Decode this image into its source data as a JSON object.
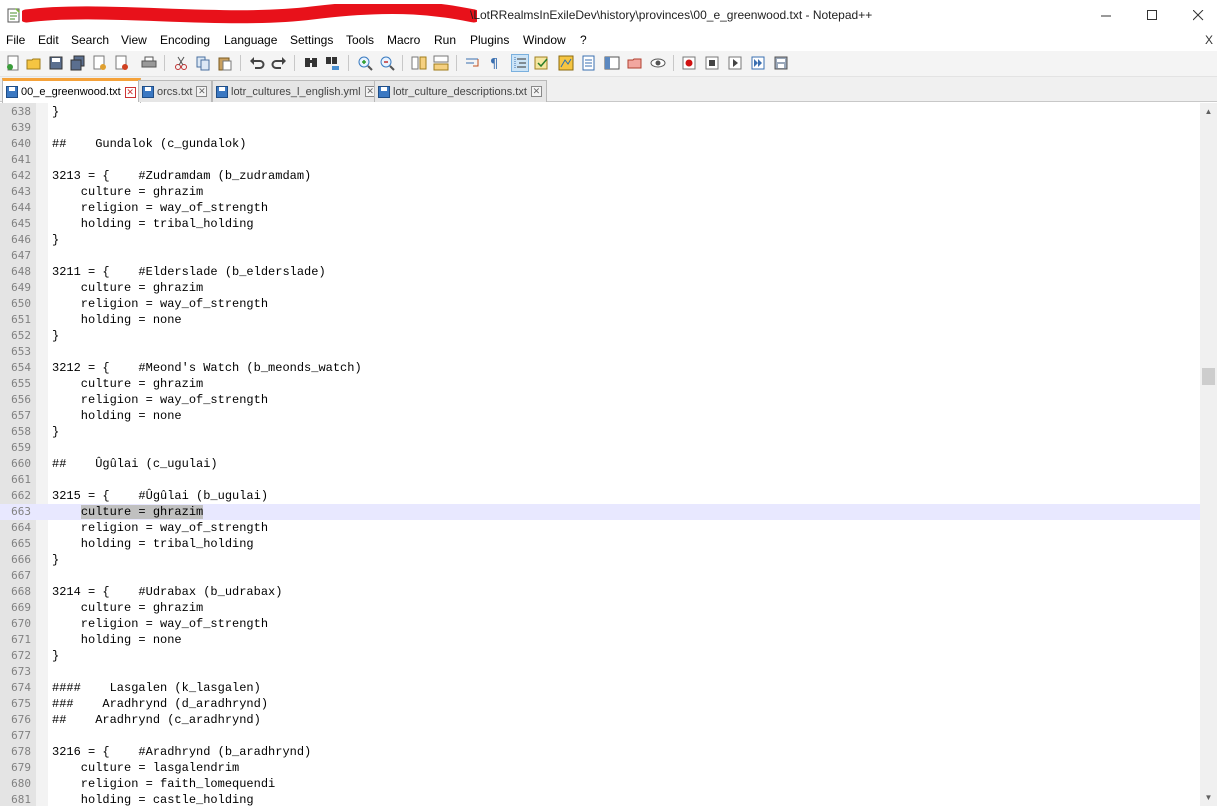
{
  "window": {
    "title": "\\LotRRealmsInExileDev\\history\\provinces\\00_e_greenwood.txt - Notepad++",
    "minimize": "—",
    "maximize": "☐",
    "close": "✕"
  },
  "menu": {
    "items": [
      "File",
      "Edit",
      "Search",
      "View",
      "Encoding",
      "Language",
      "Settings",
      "Tools",
      "Macro",
      "Run",
      "Plugins",
      "Window",
      "?"
    ],
    "close": "X"
  },
  "tabs": [
    {
      "label": "00_e_greenwood.txt",
      "active": true
    },
    {
      "label": "orcs.txt",
      "active": false
    },
    {
      "label": "lotr_cultures_l_english.yml",
      "active": false
    },
    {
      "label": "lotr_culture_descriptions.txt",
      "active": false
    }
  ],
  "editor": {
    "current_line": "663",
    "selected_text": "culture = ghrazim",
    "lines": [
      {
        "n": "638",
        "t": "}"
      },
      {
        "n": "639",
        "t": ""
      },
      {
        "n": "640",
        "t": "##    Gundalok (c_gundalok)"
      },
      {
        "n": "641",
        "t": ""
      },
      {
        "n": "642",
        "t": "3213 = {    #Zudramdam (b_zudramdam)"
      },
      {
        "n": "643",
        "t": "    culture = ghrazim"
      },
      {
        "n": "644",
        "t": "    religion = way_of_strength"
      },
      {
        "n": "645",
        "t": "    holding = tribal_holding"
      },
      {
        "n": "646",
        "t": "}"
      },
      {
        "n": "647",
        "t": ""
      },
      {
        "n": "648",
        "t": "3211 = {    #Elderslade (b_elderslade)"
      },
      {
        "n": "649",
        "t": "    culture = ghrazim"
      },
      {
        "n": "650",
        "t": "    religion = way_of_strength"
      },
      {
        "n": "651",
        "t": "    holding = none"
      },
      {
        "n": "652",
        "t": "}"
      },
      {
        "n": "653",
        "t": ""
      },
      {
        "n": "654",
        "t": "3212 = {    #Meond's Watch (b_meonds_watch)"
      },
      {
        "n": "655",
        "t": "    culture = ghrazim"
      },
      {
        "n": "656",
        "t": "    religion = way_of_strength"
      },
      {
        "n": "657",
        "t": "    holding = none"
      },
      {
        "n": "658",
        "t": "}"
      },
      {
        "n": "659",
        "t": ""
      },
      {
        "n": "660",
        "t": "##    Ûgûlai (c_ugulai)"
      },
      {
        "n": "661",
        "t": ""
      },
      {
        "n": "662",
        "t": "3215 = {    #Ûgûlai (b_ugulai)"
      },
      {
        "n": "663",
        "t": "    culture = ghrazim"
      },
      {
        "n": "664",
        "t": "    religion = way_of_strength"
      },
      {
        "n": "665",
        "t": "    holding = tribal_holding"
      },
      {
        "n": "666",
        "t": "}"
      },
      {
        "n": "667",
        "t": ""
      },
      {
        "n": "668",
        "t": "3214 = {    #Udrabax (b_udrabax)"
      },
      {
        "n": "669",
        "t": "    culture = ghrazim"
      },
      {
        "n": "670",
        "t": "    religion = way_of_strength"
      },
      {
        "n": "671",
        "t": "    holding = none"
      },
      {
        "n": "672",
        "t": "}"
      },
      {
        "n": "673",
        "t": ""
      },
      {
        "n": "674",
        "t": "####    Lasgalen (k_lasgalen)"
      },
      {
        "n": "675",
        "t": "###    Aradhrynd (d_aradhrynd)"
      },
      {
        "n": "676",
        "t": "##    Aradhrynd (c_aradhrynd)"
      },
      {
        "n": "677",
        "t": ""
      },
      {
        "n": "678",
        "t": "3216 = {    #Aradhrynd (b_aradhrynd)"
      },
      {
        "n": "679",
        "t": "    culture = lasgalendrim"
      },
      {
        "n": "680",
        "t": "    religion = faith_lomequendi"
      },
      {
        "n": "681",
        "t": "    holding = castle_holding"
      }
    ]
  },
  "scrollbar": {
    "position": 0.38
  },
  "colors": {
    "accent_tab": "#f5a23a",
    "current_line": "#e8e8ff",
    "selection": "#c0c0c0",
    "redaction": "#e8111a"
  }
}
